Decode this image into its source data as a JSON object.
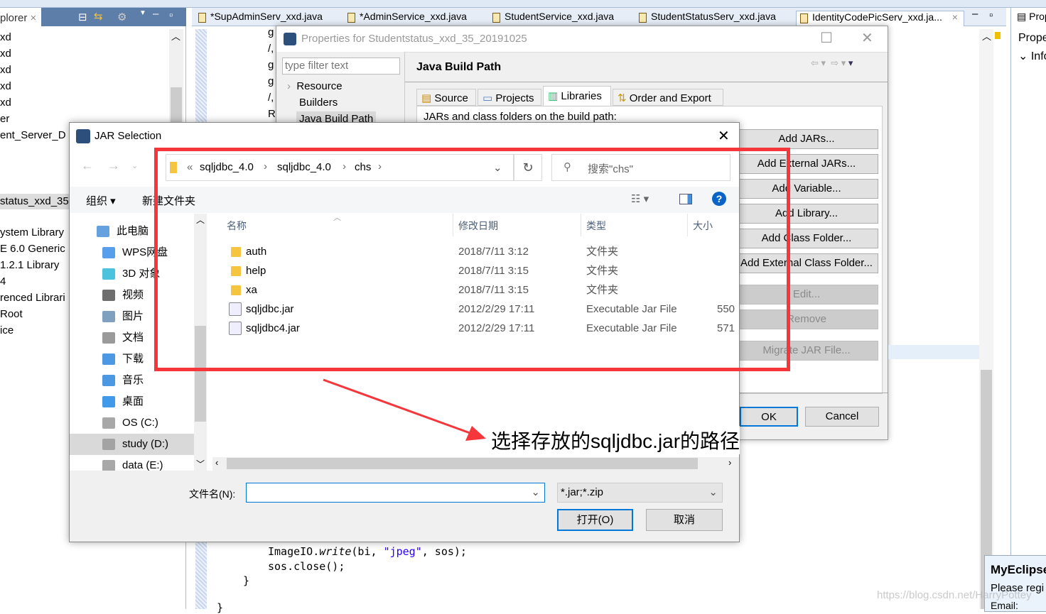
{
  "explorer": {
    "tab_label": "plorer",
    "items_top": [
      "xd",
      "xd",
      "xd",
      "xd",
      "xd",
      "er",
      "ent_Server_D"
    ],
    "project": "status_xxd_35",
    "items_bottom": [
      "ystem Library",
      "E 6.0 Generic",
      "1.2.1 Library",
      "4",
      "renced Librari",
      "Root",
      "ice"
    ]
  },
  "editor": {
    "tabs": [
      "*SupAdminServ_xxd.java",
      "*AdminService_xxd.java",
      "StudentService_xxd.java",
      "StudentStatusServ_xxd.java",
      "IdentityCodePicServ_xxd.ja..."
    ],
    "code_partial": [
      "g",
      "/,",
      "g",
      "g",
      "/,",
      "R;",
      "g"
    ],
    "code_lines": [
      "ImageIO.write(bi, \"jpeg\", sos);",
      "sos.close();",
      "}",
      "}"
    ],
    "code_tokens": {
      "pre": "ImageIO.",
      "method": "write",
      "args1": "(bi, ",
      "string": "\"jpeg\"",
      "args2": ", sos);"
    }
  },
  "right_panel": {
    "tab": "Prop",
    "title": "Prope",
    "section": "Info"
  },
  "properties_dialog": {
    "title": "Properties for Studentstatus_xxd_35_20191025",
    "filter_placeholder": "type filter text",
    "tree": [
      "Resource",
      "Builders",
      "Java Build Path"
    ],
    "page_title": "Java Build Path",
    "tabs": [
      "Source",
      "Projects",
      "Libraries",
      "Order and Export"
    ],
    "active_tab": "Libraries",
    "content_label": "JARs and class folders on the build path:",
    "buttons": [
      "Add JARs...",
      "Add External JARs...",
      "Add Variable...",
      "Add Library...",
      "Add Class Folder...",
      "Add External Class Folder..."
    ],
    "disabled_buttons": [
      "Edit...",
      "Remove",
      "Migrate JAR File..."
    ],
    "ok": "OK",
    "cancel": "Cancel"
  },
  "jar_dialog": {
    "title": "JAR Selection",
    "breadcrumb": [
      "«",
      "sqljdbc_4.0",
      "sqljdbc_4.0",
      "chs"
    ],
    "search_placeholder": "搜索\"chs\"",
    "organize": "组织 ▾",
    "new_folder": "新建文件夹",
    "nav_items": [
      {
        "label": "此电脑",
        "icon": "computer-icon",
        "color": "#4a90d9"
      },
      {
        "label": "WPS网盘",
        "icon": "cloud-icon",
        "color": "#3a8ee6"
      },
      {
        "label": "3D 对象",
        "icon": "cube-icon",
        "color": "#2bb8d6"
      },
      {
        "label": "视频",
        "icon": "video-icon",
        "color": "#555"
      },
      {
        "label": "图片",
        "icon": "picture-icon",
        "color": "#6a8fb5"
      },
      {
        "label": "文档",
        "icon": "document-icon",
        "color": "#888"
      },
      {
        "label": "下载",
        "icon": "download-icon",
        "color": "#2e86de"
      },
      {
        "label": "音乐",
        "icon": "music-icon",
        "color": "#2e86de"
      },
      {
        "label": "桌面",
        "icon": "desktop-icon",
        "color": "#1e88e5"
      },
      {
        "label": "OS (C:)",
        "icon": "drive-icon",
        "color": "#999"
      },
      {
        "label": "study (D:)",
        "icon": "drive-icon",
        "color": "#999"
      },
      {
        "label": "data (E:)",
        "icon": "drive-icon",
        "color": "#999"
      }
    ],
    "selected_nav": "study (D:)",
    "columns": [
      "名称",
      "修改日期",
      "类型",
      "大小"
    ],
    "files": [
      {
        "name": "auth",
        "date": "2018/7/11 3:12",
        "type": "文件夹",
        "size": "",
        "kind": "folder"
      },
      {
        "name": "help",
        "date": "2018/7/11 3:15",
        "type": "文件夹",
        "size": "",
        "kind": "folder"
      },
      {
        "name": "xa",
        "date": "2018/7/11 3:15",
        "type": "文件夹",
        "size": "",
        "kind": "folder"
      },
      {
        "name": "sqljdbc.jar",
        "date": "2012/2/29 17:11",
        "type": "Executable Jar File",
        "size": "550",
        "kind": "jar"
      },
      {
        "name": "sqljdbc4.jar",
        "date": "2012/2/29 17:11",
        "type": "Executable Jar File",
        "size": "571",
        "kind": "jar"
      }
    ],
    "filename_label": "文件名(N):",
    "filename_value": "",
    "filter": "*.jar;*.zip",
    "open": "打开(O)",
    "cancel": "取消"
  },
  "annotation": {
    "text": "选择存放的sqljdbc.jar的路径",
    "color": "#f5363a"
  },
  "popup": {
    "title": "MyEclipse",
    "line1": "Please regi",
    "line2": "Email:"
  },
  "watermark": "https://blog.csdn.net/HarryPottey"
}
